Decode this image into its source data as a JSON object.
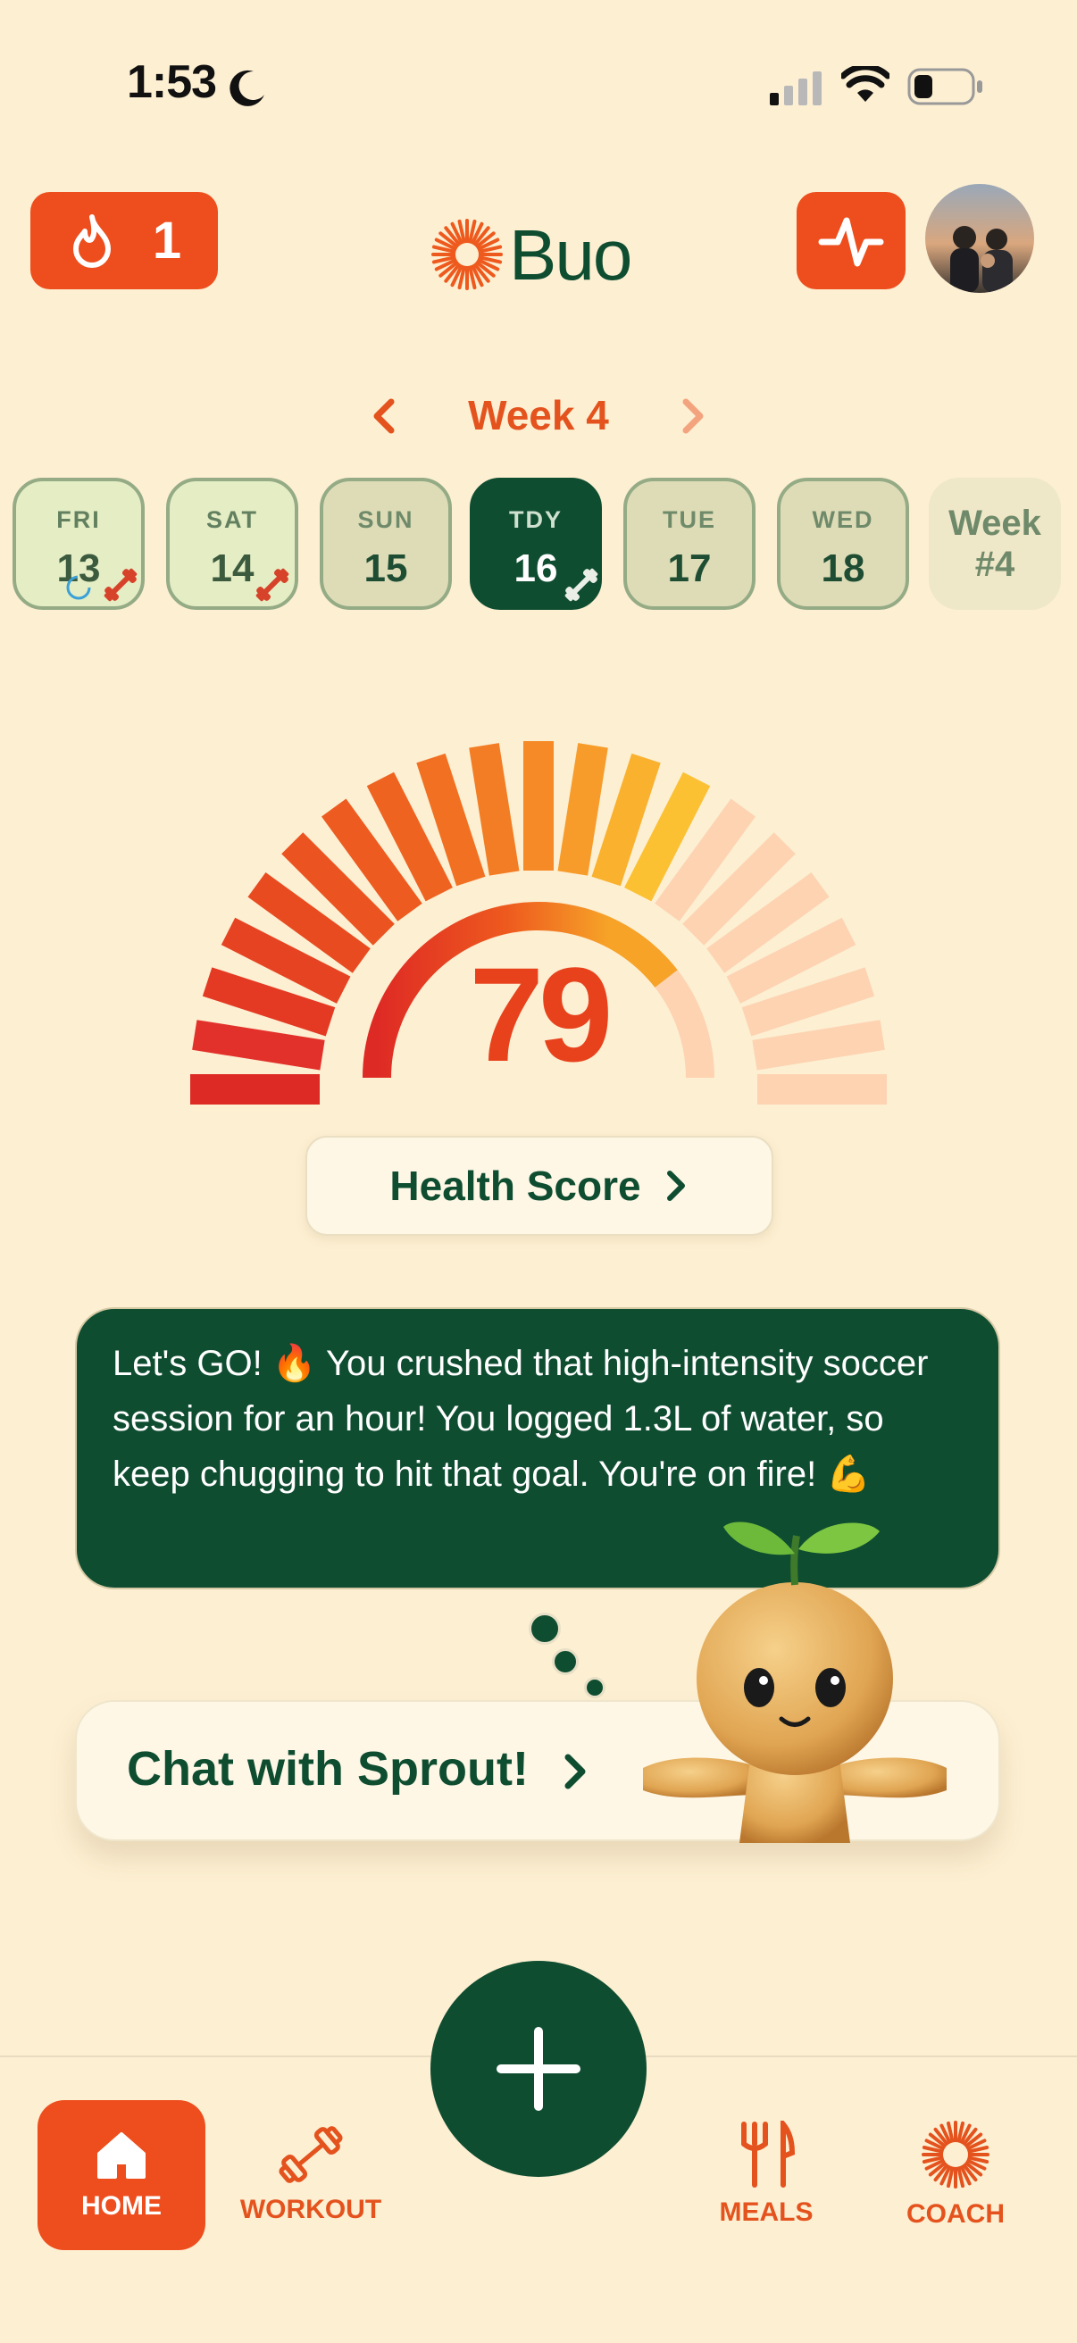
{
  "status_bar": {
    "time": "1:53"
  },
  "header": {
    "streak_count": "1",
    "logo_text": "Buo"
  },
  "week_nav": {
    "label": "Week 4"
  },
  "days": [
    {
      "dow": "FRI",
      "num": "13"
    },
    {
      "dow": "SAT",
      "num": "14"
    },
    {
      "dow": "SUN",
      "num": "15"
    },
    {
      "dow": "TDY",
      "num": "16"
    },
    {
      "dow": "TUE",
      "num": "17"
    },
    {
      "dow": "WED",
      "num": "18"
    }
  ],
  "week_pill": {
    "line1": "Week",
    "line2": "#4"
  },
  "health": {
    "score": "79",
    "button_label": "Health Score"
  },
  "message": {
    "text": "Let's GO! 🔥 You crushed that high-intensity soccer session for an hour! You logged 1.3L of water, so keep chugging to hit that goal. You're on fire! 💪"
  },
  "chat": {
    "label": "Chat with Sprout!"
  },
  "tabs": {
    "home": "HOME",
    "workout": "WORKOUT",
    "meals": "MEALS",
    "coach": "COACH"
  },
  "colors": {
    "background": "#FDEFD2",
    "brand_green": "#0F4D31",
    "accent_orange": "#EE4E1D"
  }
}
